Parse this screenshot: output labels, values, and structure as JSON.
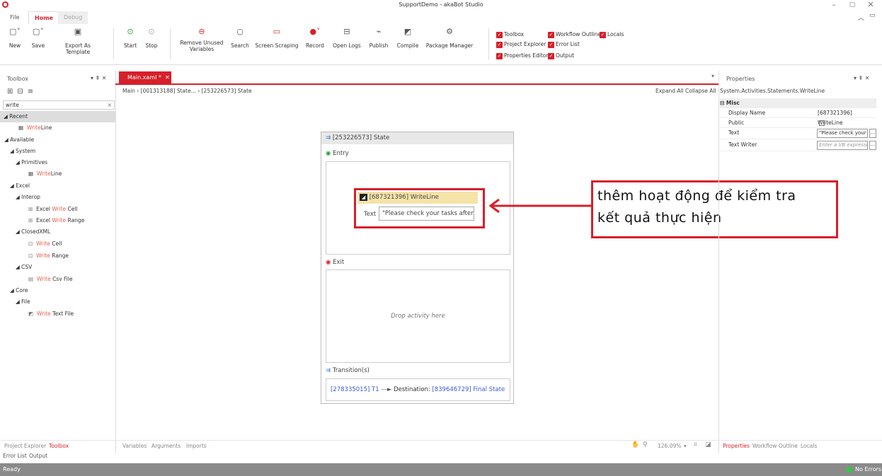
{
  "app": {
    "title": "SupportDemo - akaBot Studio"
  },
  "window_controls": {
    "minimize": "–",
    "restore": "▢",
    "close": "✕"
  },
  "ribbon_tabs": [
    "File",
    "Home",
    "Debug"
  ],
  "ribbon": {
    "new": "New",
    "save": "Save",
    "export": "Export As Template",
    "start": "Start",
    "stop": "Stop",
    "remove_unused": "Remove Unused Variables",
    "search": "Search",
    "screen_scraping": "Screen Scraping",
    "record": "Record",
    "open_logs": "Open Logs",
    "publish": "Publish",
    "compile": "Compile",
    "package_manager": "Package Manager"
  },
  "panels_toggle": {
    "toolbox": "Toolbox",
    "project_explorer": "Project Explorer",
    "properties_editor": "Properties Editor",
    "workflow_outline": "Workflow Outline",
    "locals": "Locals",
    "error_list": "Error List",
    "output": "Output"
  },
  "toolbox": {
    "title": "Toolbox",
    "search_value": "write",
    "recent": "Recent",
    "available": "Available",
    "items": {
      "writeline_hl": "Write",
      "line": "Line",
      "system": "System",
      "primitives": "Primitives",
      "excel": "Excel",
      "interop": "Interop",
      "excel_pre": "Excel ",
      "cell": " Cell",
      "range": " Range",
      "closedxml": "ClosedXML",
      "csv": "CSV",
      "csvfile": " Csv File",
      "core": "Core",
      "file": "File",
      "textfile": " Text File"
    }
  },
  "document": {
    "tab": "Main.xaml *",
    "breadcrumb": "Main  ›  [001313188] State...  ›  [253226573] State",
    "expand_all": "Expand All",
    "collapse_all": "Collapse All",
    "state_title": "[253226573] State",
    "entry": "Entry",
    "writeline_title": "[687321396] WriteLine",
    "text_label": "Text",
    "text_value": "\"Please check your tasks after",
    "exit": "Exit",
    "drop_hint": "Drop activity here",
    "transitions": "Transition(s)",
    "transition_id": "[278335015] T1",
    "destination_label": "Destination:",
    "destination_value": "[839646729] Final State"
  },
  "callout": {
    "line1": "thêm hoạt động để kiểm tra",
    "line2": "kết quả thực hiện"
  },
  "properties": {
    "title": "Properties",
    "type": "System.Activities.Statements.WriteLine",
    "category": "Misc",
    "display_name_label": "Display Name",
    "display_name_value": "[687321396] WriteLine",
    "public_label": "Public",
    "text_label": "Text",
    "text_value": "\"Please check your",
    "text_writer_label": "Text Writer",
    "text_writer_placeholder": "Enter a VB expressi"
  },
  "bottom_tabs": {
    "left": [
      "Project Explorer",
      "Toolbox"
    ],
    "left2": [
      "Error List",
      "Output"
    ],
    "center": [
      "Variables",
      "Arguments",
      "Imports"
    ],
    "right": [
      "Properties",
      "Workflow Outline",
      "Locals"
    ]
  },
  "zoom": "126.09%",
  "status": {
    "ready": "Ready",
    "errors": "No Errors"
  },
  "colors": {
    "accent": "#d6202a",
    "highlight": "#e8614c"
  }
}
